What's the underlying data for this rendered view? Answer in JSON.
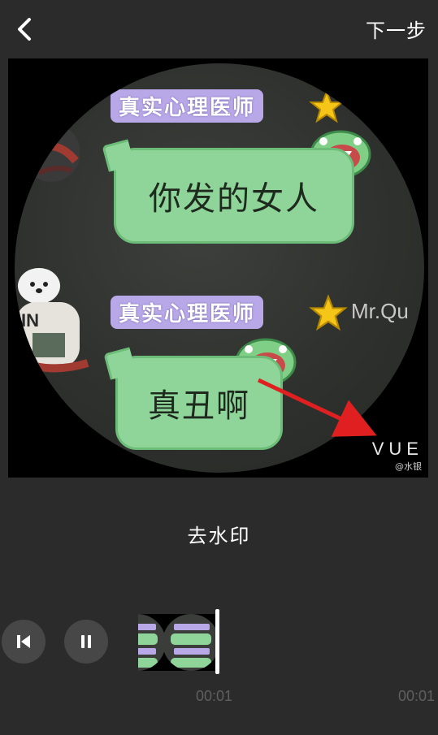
{
  "topbar": {
    "back_icon": "chevron-left-icon",
    "next_label": "下一步"
  },
  "preview": {
    "tag_1": "真实心理医师",
    "bubble_1": "你发的女人",
    "tag_2": "真实心理医师",
    "bubble_2": "真丑啊",
    "mr_text": "Mr.Qu",
    "watermark": "VUE",
    "watermark_sub": "@水银",
    "arrow_color": "#e02020"
  },
  "action": {
    "remove_watermark_label": "去水印"
  },
  "player": {
    "prev_icon": "skip-back-icon",
    "pause_icon": "pause-icon",
    "time_1": "00:01",
    "time_2": "00:01"
  },
  "colors": {
    "background": "#2b2b2b",
    "button_bg": "#474747",
    "tag_purple": "#b9a8e8",
    "bubble_green": "#8fd59a"
  }
}
